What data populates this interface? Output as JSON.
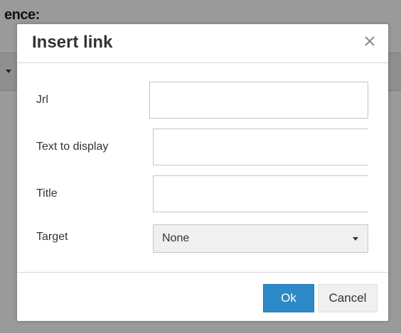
{
  "background": {
    "heading_fragment": "ence:"
  },
  "dialog": {
    "title": "Insert link",
    "close_symbol": "×",
    "fields": {
      "url": {
        "label": "Jrl",
        "value": ""
      },
      "text_to_display": {
        "label": "Text to display",
        "value": ""
      },
      "title": {
        "label": "Title",
        "value": ""
      },
      "target": {
        "label": "Target",
        "selected": "None"
      }
    },
    "buttons": {
      "ok_label": "Ok",
      "cancel_label": "Cancel"
    }
  },
  "colors": {
    "primary_button": "#2d8ac7",
    "overlay": "#9a9a9a",
    "dialog_background": "#ffffff"
  },
  "icons": {
    "close": "close-icon",
    "dropdown": "chevron-down-icon"
  }
}
